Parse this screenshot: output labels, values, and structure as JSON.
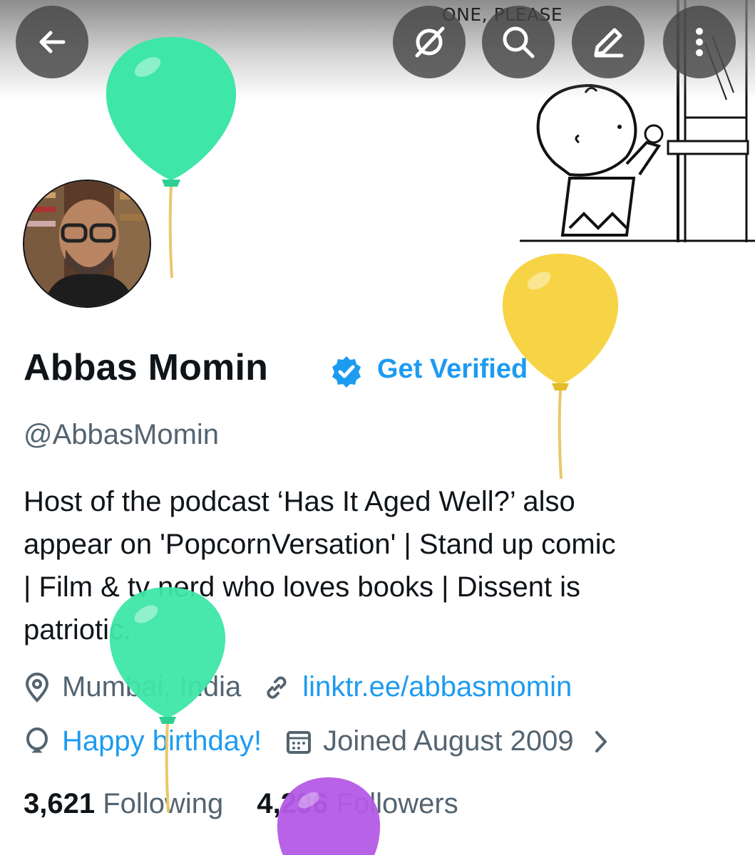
{
  "header": {
    "banner_caption": "ONE, PLEASE",
    "buttons": {
      "back": "back-arrow-icon",
      "grok": "grok-icon",
      "search": "search-icon",
      "edit": "edit-icon",
      "more": "more-vertical-icon"
    }
  },
  "profile": {
    "name": "Abbas Momin",
    "verified_icon": "verified-badge-icon",
    "get_verified_label": "Get Verified",
    "handle": "@AbbasMomin",
    "bio_lines": [
      "Host of the podcast ‘Has It Aged Well?’ also",
      "appear on 'PopcornVersation'  | Stand up comic",
      "| Film & tv nerd who loves books | Dissent is",
      "patriotic."
    ],
    "location": "Mumbai, India",
    "website": "linktr.ee/abbasmomin",
    "birthday": "Happy birthday!",
    "joined": "Joined August 2009"
  },
  "stats": {
    "following_count": "3,621",
    "following_label": "Following",
    "followers_count": "4,296",
    "followers_label": "Followers"
  },
  "colors": {
    "accent": "#1d9bf0",
    "secondary_text": "#536471",
    "primary_text": "#0f1419",
    "balloon_green": "#3ee6a8",
    "balloon_yellow": "#f7d23c",
    "balloon_purple": "#b45ae6"
  }
}
